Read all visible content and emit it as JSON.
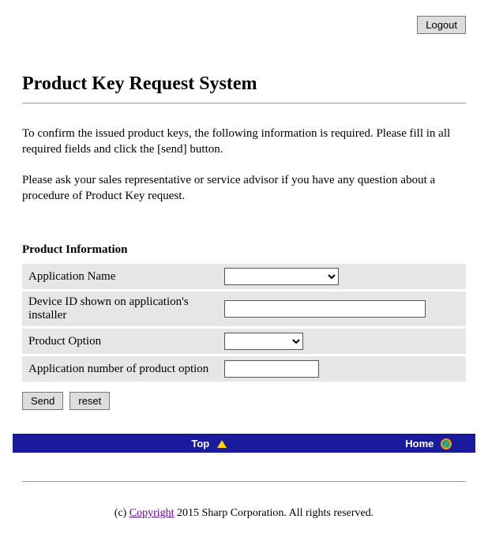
{
  "logout_label": "Logout",
  "page_title": "Product Key Request System",
  "intro_p1": "To confirm the issued product keys, the following information is required. Please fill in all required fields and click the [send] button.",
  "intro_p2": "Please ask your sales representative or service advisor if you have any question about a procedure of Product Key request.",
  "section_title": "Product Information",
  "fields": {
    "app_name_label": "Application Name",
    "device_id_label": "Device ID shown on application's installer",
    "product_option_label": "Product Option",
    "app_number_label": "Application number of product option"
  },
  "buttons": {
    "send": "Send",
    "reset": "reset"
  },
  "nav": {
    "top": "Top",
    "home": "Home"
  },
  "footer": {
    "prefix": "(c) ",
    "copyright_link": "Copyright",
    "suffix": " 2015 Sharp Corporation. All rights reserved."
  }
}
